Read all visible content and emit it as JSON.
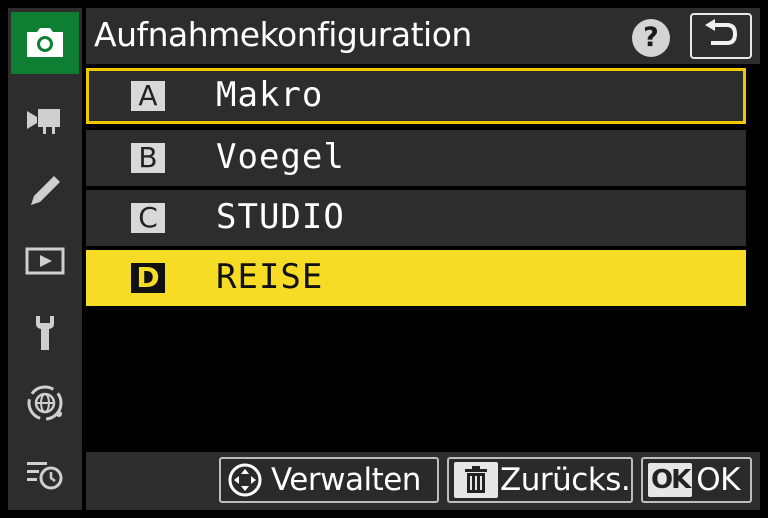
{
  "header": {
    "title": "Aufnahmekonfiguration"
  },
  "help": {
    "label": "?"
  },
  "sidebar": {
    "items": [
      {
        "name": "photo-shooting-menu",
        "icon": "camera-icon",
        "active": true
      },
      {
        "name": "video-recording-menu",
        "icon": "movie-camera-icon",
        "active": false
      },
      {
        "name": "custom-settings-menu",
        "icon": "pencil-icon",
        "active": false
      },
      {
        "name": "playback-menu",
        "icon": "playback-icon",
        "active": false
      },
      {
        "name": "setup-menu",
        "icon": "wrench-icon",
        "active": false
      },
      {
        "name": "network-menu",
        "icon": "network-globe-icon",
        "active": false
      },
      {
        "name": "my-menu",
        "icon": "recent-settings-icon",
        "active": false
      }
    ]
  },
  "banks": [
    {
      "letter": "A",
      "label": "Makro",
      "state": "focused"
    },
    {
      "letter": "B",
      "label": "Voegel",
      "state": "normal"
    },
    {
      "letter": "C",
      "label": "STUDIO",
      "state": "normal"
    },
    {
      "letter": "D",
      "label": "REISE",
      "state": "selected"
    }
  ],
  "footer": {
    "manage_label": "Verwalten",
    "reset_label": "Zurücks.",
    "ok_badge": "OK",
    "ok_label": "OK"
  },
  "colors": {
    "accent_green": "#0e7e33",
    "selection_yellow": "#f7dc26",
    "focus_yellow": "#f0c800",
    "panel_gray": "#2d2d2d"
  }
}
